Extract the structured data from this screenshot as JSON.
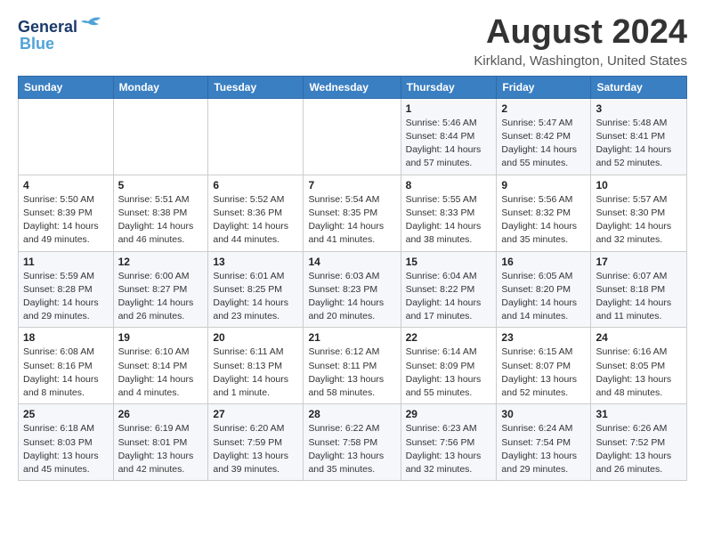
{
  "header": {
    "logo": {
      "line1": "General",
      "line2": "Blue"
    },
    "title": "August 2024",
    "subtitle": "Kirkland, Washington, United States"
  },
  "calendar": {
    "headers": [
      "Sunday",
      "Monday",
      "Tuesday",
      "Wednesday",
      "Thursday",
      "Friday",
      "Saturday"
    ],
    "weeks": [
      [
        {
          "day": "",
          "info": ""
        },
        {
          "day": "",
          "info": ""
        },
        {
          "day": "",
          "info": ""
        },
        {
          "day": "",
          "info": ""
        },
        {
          "day": "1",
          "info": "Sunrise: 5:46 AM\nSunset: 8:44 PM\nDaylight: 14 hours\nand 57 minutes."
        },
        {
          "day": "2",
          "info": "Sunrise: 5:47 AM\nSunset: 8:42 PM\nDaylight: 14 hours\nand 55 minutes."
        },
        {
          "day": "3",
          "info": "Sunrise: 5:48 AM\nSunset: 8:41 PM\nDaylight: 14 hours\nand 52 minutes."
        }
      ],
      [
        {
          "day": "4",
          "info": "Sunrise: 5:50 AM\nSunset: 8:39 PM\nDaylight: 14 hours\nand 49 minutes."
        },
        {
          "day": "5",
          "info": "Sunrise: 5:51 AM\nSunset: 8:38 PM\nDaylight: 14 hours\nand 46 minutes."
        },
        {
          "day": "6",
          "info": "Sunrise: 5:52 AM\nSunset: 8:36 PM\nDaylight: 14 hours\nand 44 minutes."
        },
        {
          "day": "7",
          "info": "Sunrise: 5:54 AM\nSunset: 8:35 PM\nDaylight: 14 hours\nand 41 minutes."
        },
        {
          "day": "8",
          "info": "Sunrise: 5:55 AM\nSunset: 8:33 PM\nDaylight: 14 hours\nand 38 minutes."
        },
        {
          "day": "9",
          "info": "Sunrise: 5:56 AM\nSunset: 8:32 PM\nDaylight: 14 hours\nand 35 minutes."
        },
        {
          "day": "10",
          "info": "Sunrise: 5:57 AM\nSunset: 8:30 PM\nDaylight: 14 hours\nand 32 minutes."
        }
      ],
      [
        {
          "day": "11",
          "info": "Sunrise: 5:59 AM\nSunset: 8:28 PM\nDaylight: 14 hours\nand 29 minutes."
        },
        {
          "day": "12",
          "info": "Sunrise: 6:00 AM\nSunset: 8:27 PM\nDaylight: 14 hours\nand 26 minutes."
        },
        {
          "day": "13",
          "info": "Sunrise: 6:01 AM\nSunset: 8:25 PM\nDaylight: 14 hours\nand 23 minutes."
        },
        {
          "day": "14",
          "info": "Sunrise: 6:03 AM\nSunset: 8:23 PM\nDaylight: 14 hours\nand 20 minutes."
        },
        {
          "day": "15",
          "info": "Sunrise: 6:04 AM\nSunset: 8:22 PM\nDaylight: 14 hours\nand 17 minutes."
        },
        {
          "day": "16",
          "info": "Sunrise: 6:05 AM\nSunset: 8:20 PM\nDaylight: 14 hours\nand 14 minutes."
        },
        {
          "day": "17",
          "info": "Sunrise: 6:07 AM\nSunset: 8:18 PM\nDaylight: 14 hours\nand 11 minutes."
        }
      ],
      [
        {
          "day": "18",
          "info": "Sunrise: 6:08 AM\nSunset: 8:16 PM\nDaylight: 14 hours\nand 8 minutes."
        },
        {
          "day": "19",
          "info": "Sunrise: 6:10 AM\nSunset: 8:14 PM\nDaylight: 14 hours\nand 4 minutes."
        },
        {
          "day": "20",
          "info": "Sunrise: 6:11 AM\nSunset: 8:13 PM\nDaylight: 14 hours\nand 1 minute."
        },
        {
          "day": "21",
          "info": "Sunrise: 6:12 AM\nSunset: 8:11 PM\nDaylight: 13 hours\nand 58 minutes."
        },
        {
          "day": "22",
          "info": "Sunrise: 6:14 AM\nSunset: 8:09 PM\nDaylight: 13 hours\nand 55 minutes."
        },
        {
          "day": "23",
          "info": "Sunrise: 6:15 AM\nSunset: 8:07 PM\nDaylight: 13 hours\nand 52 minutes."
        },
        {
          "day": "24",
          "info": "Sunrise: 6:16 AM\nSunset: 8:05 PM\nDaylight: 13 hours\nand 48 minutes."
        }
      ],
      [
        {
          "day": "25",
          "info": "Sunrise: 6:18 AM\nSunset: 8:03 PM\nDaylight: 13 hours\nand 45 minutes."
        },
        {
          "day": "26",
          "info": "Sunrise: 6:19 AM\nSunset: 8:01 PM\nDaylight: 13 hours\nand 42 minutes."
        },
        {
          "day": "27",
          "info": "Sunrise: 6:20 AM\nSunset: 7:59 PM\nDaylight: 13 hours\nand 39 minutes."
        },
        {
          "day": "28",
          "info": "Sunrise: 6:22 AM\nSunset: 7:58 PM\nDaylight: 13 hours\nand 35 minutes."
        },
        {
          "day": "29",
          "info": "Sunrise: 6:23 AM\nSunset: 7:56 PM\nDaylight: 13 hours\nand 32 minutes."
        },
        {
          "day": "30",
          "info": "Sunrise: 6:24 AM\nSunset: 7:54 PM\nDaylight: 13 hours\nand 29 minutes."
        },
        {
          "day": "31",
          "info": "Sunrise: 6:26 AM\nSunset: 7:52 PM\nDaylight: 13 hours\nand 26 minutes."
        }
      ]
    ]
  }
}
